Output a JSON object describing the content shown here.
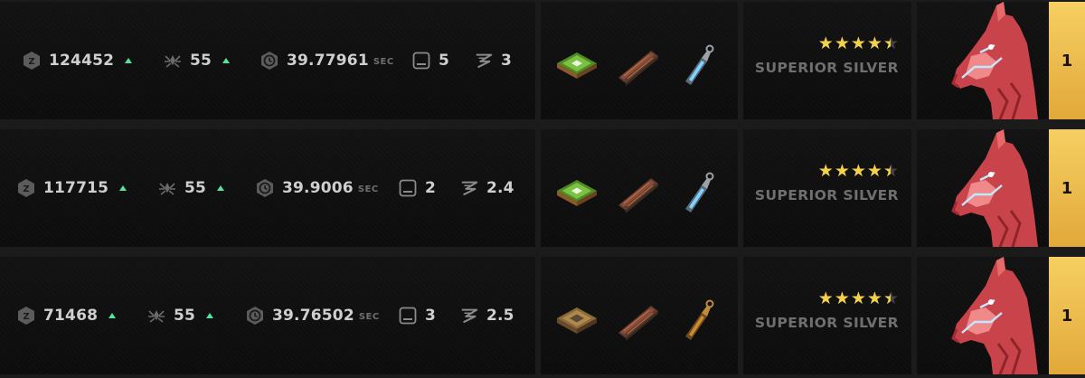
{
  "rows": [
    {
      "points": "124452",
      "level": "55",
      "time": "39.77961",
      "time_unit": "SEC",
      "slots": "5",
      "z_value": "3",
      "parts": [
        "chip-green",
        "ram-stick",
        "tube-blue"
      ],
      "stars": 4.5,
      "grade": "SUPERIOR SILVER",
      "rank": "1"
    },
    {
      "points": "117715",
      "level": "55",
      "time": "39.9006",
      "time_unit": "SEC",
      "slots": "2",
      "z_value": "2.4",
      "parts": [
        "chip-green",
        "ram-stick",
        "tube-blue"
      ],
      "stars": 4.5,
      "grade": "SUPERIOR SILVER",
      "rank": "1"
    },
    {
      "points": "71468",
      "level": "55",
      "time": "39.76502",
      "time_unit": "SEC",
      "slots": "3",
      "z_value": "2.5",
      "parts": [
        "chip-gold",
        "ram-stick",
        "tube-orange"
      ],
      "stars": 4.5,
      "grade": "SUPERIOR SILVER",
      "rank": "1"
    }
  ],
  "colors": {
    "up_arrow": "#58e39a",
    "star": "#f3d24a",
    "rank_badge": "#f0be4e",
    "horse_red": "#e05a5a",
    "tube_blue": "#7fd3ff",
    "tube_orange": "#d08a2a",
    "chip_green": "#7cc242",
    "chip_gold": "#b08a4a"
  },
  "icons": [
    "z-token-icon",
    "level-spider-icon",
    "clock-icon",
    "slot-icon",
    "z-brand-icon",
    "up-arrow-icon",
    "star-icon",
    "horse-head-icon"
  ]
}
